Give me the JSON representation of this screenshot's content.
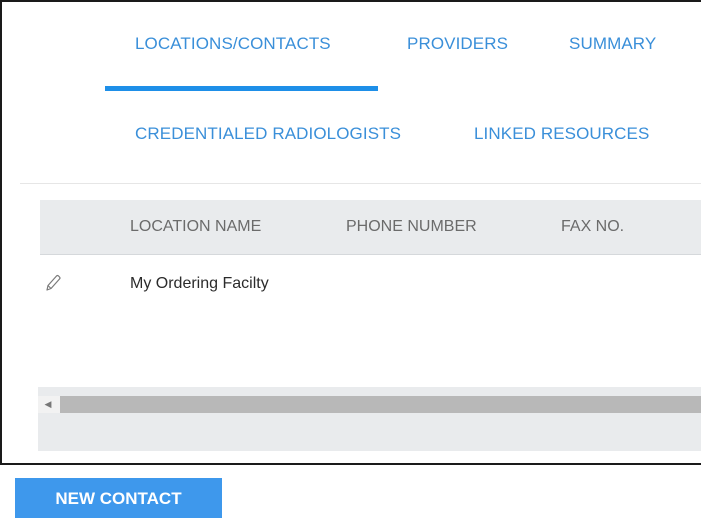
{
  "tabs": [
    {
      "label": "LOCATIONS/CONTACTS",
      "active": true
    },
    {
      "label": "PROVIDERS"
    },
    {
      "label": "SUMMARY"
    },
    {
      "label": "CREDENTIALED RADIOLOGISTS"
    },
    {
      "label": "LINKED RESOURCES"
    }
  ],
  "grid": {
    "columns": [
      "LOCATION NAME",
      "PHONE NUMBER",
      "FAX NO."
    ],
    "rows": [
      {
        "location_name": "My Ordering Facilty",
        "phone_number": "",
        "fax_no": ""
      }
    ]
  },
  "actions": {
    "new_contact_label": "NEW CONTACT"
  },
  "icons": {
    "edit": "pencil-icon",
    "scroll_left": "caret-left-icon"
  },
  "colors": {
    "accent": "#1e8fe8",
    "tab_text": "#3a8fd9",
    "button": "#3e98ec",
    "header_bg": "#e9ebed"
  }
}
